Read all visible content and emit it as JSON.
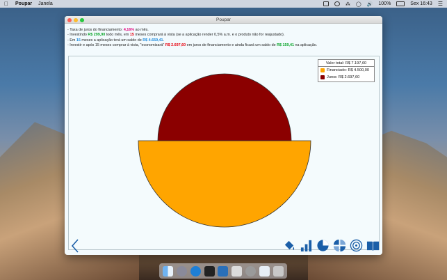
{
  "menubar": {
    "app_name": "Poupar",
    "menus": [
      "Janela"
    ],
    "battery": "100%",
    "clock": "Sex 16:43"
  },
  "window": {
    "title": "Poupar",
    "info_lines": [
      [
        "- Taxa de juros do financiamento: ",
        "4,16%",
        " ao mês."
      ],
      [
        "- Investindo ",
        "R$ 299,90",
        " todo mês, em ",
        "15",
        " meses comprará à vista (se a aplicação render 0,5% a.m. e o produto não for reajustado)."
      ],
      [
        "- Em ",
        "15",
        " meses a aplicação terá um saldo de ",
        "R$ 4.659,41",
        "."
      ],
      [
        "- Investir e após 15 meses comprar à vista, \"economizará\" ",
        "R$ 2.697,60",
        " em juros de financiamento e ainda ficará um saldo de ",
        "R$ 159,41",
        " na aplicação."
      ]
    ],
    "legend": {
      "total": "Valor total: R$ 7.197,60",
      "financiado": "Financiado: R$ 4.500,00",
      "juros": "Juros: R$ 2.697,60"
    }
  },
  "chart_data": {
    "type": "pie",
    "slices": [
      {
        "label": "Financiado",
        "value": 4500.0,
        "color": "#ffa500"
      },
      {
        "label": "Juros",
        "value": 2697.6,
        "color": "#8b0000"
      }
    ],
    "total": 7197.6
  },
  "colors": {
    "financiado": "#ffa500",
    "juros": "#8b0000",
    "icon_blue": "#1b5fa8"
  },
  "toolbar": {
    "icons": [
      "back-icon",
      "paint-bucket-icon",
      "bar-chart-icon",
      "pie-chart-icon",
      "split-pie-icon",
      "disc-chart-icon",
      "book-icon"
    ]
  }
}
